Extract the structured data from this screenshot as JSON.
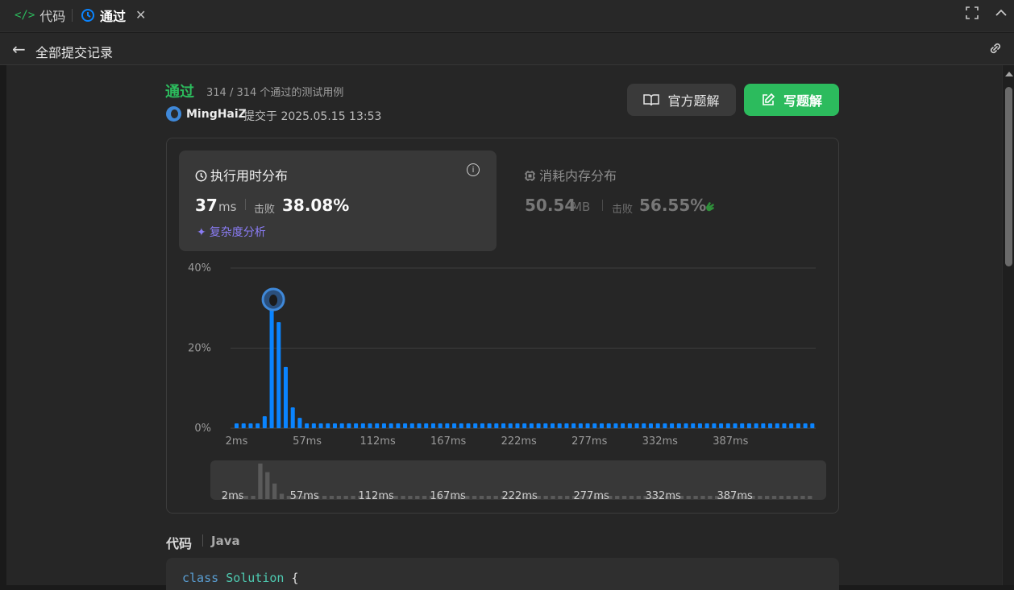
{
  "tabs": [
    {
      "label": "代码",
      "icon": "code-icon"
    },
    {
      "label": "通过",
      "icon": "history-icon"
    }
  ],
  "subbar": {
    "title": "全部提交记录"
  },
  "submission": {
    "status": "通过",
    "tests": "314 / 314 个通过的测试用例",
    "user": "MingHaiZ",
    "submitted_at": "提交于 2025.05.15 13:53"
  },
  "buttons": {
    "official": "官方题解",
    "write": "写题解"
  },
  "runtime": {
    "title": "执行用时分布",
    "value": "37",
    "unit": "ms",
    "beat_label": "击败",
    "beat_pct": "38.08%",
    "complexity": "复杂度分析"
  },
  "memory": {
    "title": "消耗内存分布",
    "value": "50.54",
    "unit": "MB",
    "beat_label": "击败",
    "beat_pct": "56.55%"
  },
  "chart_data": {
    "type": "bar",
    "ylabel": "",
    "xlabel": "",
    "ylim": [
      0,
      40
    ],
    "y_ticks": [
      "0%",
      "20%",
      "40%"
    ],
    "x_ticks": [
      "2ms",
      "57ms",
      "112ms",
      "167ms",
      "222ms",
      "277ms",
      "332ms",
      "387ms"
    ],
    "grid": true,
    "unit": "%",
    "current_bar_index": 6,
    "values": [
      1.2,
      1.2,
      1.2,
      1.2,
      3.0,
      35.0,
      26.5,
      15.3,
      5.2,
      2.6,
      1.2,
      1.2,
      1.2,
      1.2,
      1.2,
      1.2,
      1.2,
      1.2,
      1.2,
      1.2,
      1.2,
      1.2,
      1.2,
      1.2,
      1.2,
      1.2,
      1.2,
      1.2,
      1.2,
      1.2,
      1.2,
      1.2,
      1.2,
      1.2,
      1.2,
      1.2,
      1.2,
      1.2,
      1.2,
      1.2,
      1.2,
      1.2,
      1.2,
      1.2,
      1.2,
      1.2,
      1.2,
      1.2,
      1.2,
      1.2,
      1.2,
      1.2,
      1.2,
      1.2,
      1.2,
      1.2,
      1.2,
      1.2,
      1.2,
      1.2,
      1.2,
      1.2,
      1.2,
      1.2,
      1.2,
      1.2,
      1.2,
      1.2,
      1.2,
      1.2,
      1.2,
      1.2,
      1.2,
      1.2,
      1.2,
      1.2,
      1.2,
      1.2,
      1.2,
      1.2,
      1.2,
      1.2,
      1.2
    ],
    "bar_color": "#0a84ff",
    "overview_color": "#5a5a5a"
  },
  "code": {
    "label": "代码",
    "language": "Java",
    "line1_kw": "class",
    "line1_cls": "Solution",
    "line1_rest": " {"
  },
  "colors": {
    "accent_green": "#2cbb5d",
    "bar_blue": "#0a84ff",
    "complexity_purple": "#8a7cf4"
  }
}
